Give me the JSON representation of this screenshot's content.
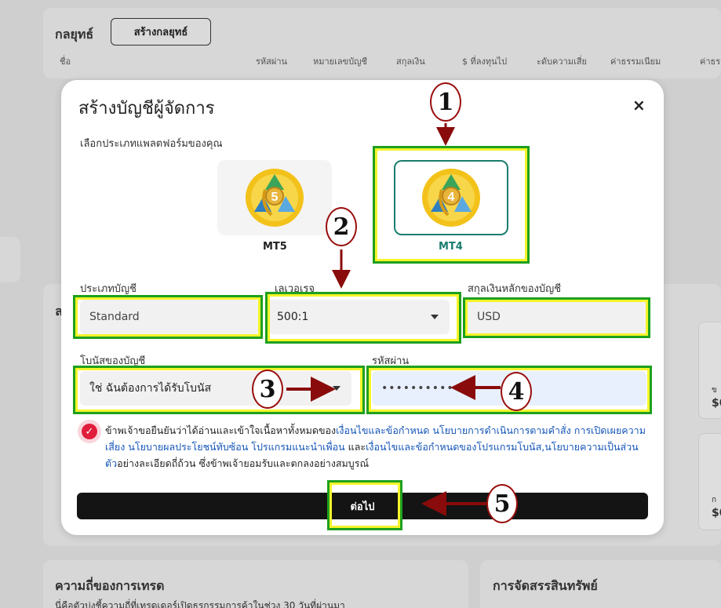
{
  "background": {
    "strategy_title": "กลยุทธ์",
    "create_strategy_button": "สร้างกลยุทธ์",
    "columns": [
      "ชื่อ",
      "รหัสผ่าน",
      "หมายเลขบัญชี",
      "สกุลเงิน",
      "$ ที่ลงทุนไป",
      "ะดับความเสี่ย",
      "ค่าธรรมเนียม",
      "ค่าธรร"
    ],
    "trade_frequency_title": "ความถี่ของการเทรด",
    "trade_frequency_sub": "นี่คือตัวบ่งชี้ความถี่ที่เทรดเดอร์เปิดธุรกรรมการค้าในช่วง 30 วันที่ผ่านมา",
    "asset_allocation_title": "การจัดสรรสินทรัพย์",
    "partial_a": "ล",
    "partial_b": "ข",
    "partial_c": "$0",
    "partial_d": "ก",
    "partial_e": "$0"
  },
  "modal": {
    "title": "สร้างบัญชีผู้จัดการ",
    "close_glyph": "×",
    "platform_label": "เลือกประเภทแพลตฟอร์มของคุณ",
    "platforms": [
      {
        "name": "MT5",
        "digit": "5",
        "selected": false
      },
      {
        "name": "MT4",
        "digit": "4",
        "selected": true
      }
    ],
    "account_type_label": "ประเภทบัญชี",
    "account_type_value": "Standard",
    "leverage_label": "เลเวอเรจ",
    "leverage_value": "500:1",
    "currency_label": "สกุลเงินหลักของบัญชี",
    "currency_value": "USD",
    "bonus_label": "โบนัสของบัญชี",
    "bonus_value": "ใช่ ฉันต้องการได้รับโบนัส",
    "password_label": "รหัสผ่าน",
    "password_value": "••••••••••",
    "checkbox_checked": true,
    "terms": {
      "t1": "ข้าพเจ้าขอยืนยันว่าได้อ่านและเข้าใจเนื้อหาทั้งหมดของ",
      "l1": "เงื่อนไขและข้อกำหนด",
      "l2": " นโยบายการดำเนินการตามคำสั่ง",
      "l3": " การเปิดเผยความเสี่ยง",
      "l4": " นโยบายผลประโยชน์ทับซ้อน",
      "l5": " โปรแกรมแนะนำเพื่อน",
      "t2": " และ",
      "l6": "เงื่อนไขและข้อกำหนดของโปรแกรมโบนัส,นโยบายความเป็นส่วนตัว",
      "t3": "อย่างละเอียดถี่ถ้วน ซึ่งข้าพเจ้ายอมรับและตกลงอย่างสมบูรณ์"
    },
    "next_button": "ต่อไป"
  },
  "annotations": {
    "step1": "1",
    "step2": "2",
    "step3": "3",
    "step4": "4",
    "step5": "5"
  },
  "colors": {
    "highlight_border": "#1ea01e",
    "highlight_fill": "#f4f42a",
    "annotation_red": "#9a0e0e",
    "mt4_teal": "#1a7d6e",
    "checkbox_red": "#e01e3c",
    "link_blue": "#1455b8"
  },
  "icons": {
    "platform_logo": "metatrader-logo-icon",
    "close": "close-icon",
    "dropdown": "chevron-down-icon",
    "check": "checkmark-icon"
  }
}
